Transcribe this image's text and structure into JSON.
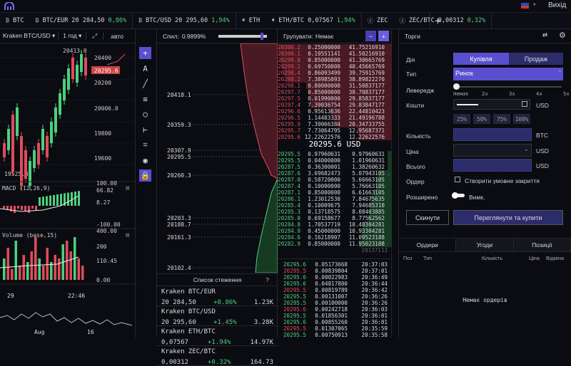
{
  "header": {
    "logout_label": "Вихід"
  },
  "ticker": [
    {
      "pair": "BTC",
      "price": "",
      "change": "",
      "dir": "",
      "icon": "btc-icon"
    },
    {
      "pair": "BTC/EUR",
      "price": "20 284,50",
      "change": "0,86%",
      "dir": "up",
      "icon": "btc-icon"
    },
    {
      "pair": "BTC/USD",
      "price": "20 295,60",
      "change": "1,94%",
      "dir": "up",
      "icon": "btc-icon"
    },
    {
      "pair": "ETH",
      "price": "",
      "change": "",
      "dir": "",
      "icon": "eth-icon"
    },
    {
      "pair": "ETH/BTC",
      "price": "0,07567",
      "change": "1,94%",
      "dir": "up",
      "icon": "eth-icon"
    },
    {
      "pair": "ZEC",
      "price": "",
      "change": "",
      "dir": "",
      "icon": "zec-icon"
    },
    {
      "pair": "ZEC/BTC",
      "price": "0,00312",
      "change": "0,32%",
      "dir": "up",
      "icon": "zec-icon"
    }
  ],
  "chart": {
    "market": "Kraken BTC/USD",
    "interval": "1 год",
    "mode": "авто",
    "price_labels": [
      "20413.0",
      "20400",
      "20295.6",
      "20200",
      "20006.0",
      "19800",
      "19600",
      "19525.8"
    ],
    "macd_label": "MACD (12,26,9)",
    "macd_ticks": [
      "100.00",
      "66.82",
      "8.27",
      "-100.00"
    ],
    "vol_label": "Volume (base,15)",
    "vol_ticks": [
      "400.00",
      "200",
      "110.45",
      "0.00"
    ],
    "time_labels": [
      "29",
      "22:46"
    ],
    "date_labels": [
      "Aug",
      "16"
    ]
  },
  "depth": {
    "spread_label": "Спил:",
    "spread_value": "0.9899%",
    "levels": [
      "20418.1",
      "20359.3",
      "20307.9",
      "20295.5",
      "20260.3",
      "20203.3",
      "20188.7",
      "20161.3",
      "20102.4"
    ],
    "watch_title": "Список стеження",
    "watch_help": "?"
  },
  "watchlist": [
    {
      "name": "Kraken BTC/EUR",
      "price": "20 284,50",
      "change": "+0.86%",
      "vol": "1.23K"
    },
    {
      "name": "Kraken BTC/USD",
      "price": "20 295,60",
      "change": "+1.45%",
      "vol": "3.28K"
    },
    {
      "name": "Kraken ETH/BTC",
      "price": "0,07567",
      "change": "+1.94%",
      "vol": "14.97K"
    },
    {
      "name": "Kraken ZEC/BTC",
      "price": "0,00312",
      "change": "+0.32%",
      "vol": "164.73"
    }
  ],
  "orderbook": {
    "group_label": "Групувати:",
    "group_value": "Немає",
    "mid_price": "20295.6 USD",
    "time": "20137113",
    "asks": [
      [
        "20300.2",
        "0.25000000",
        "41.75216910"
      ],
      [
        "20300.1",
        "0.19551141",
        "41.50216910"
      ],
      [
        "20299.8",
        "0.85000000",
        "41.30665769"
      ],
      [
        "20299.2",
        "0.69750000",
        "40.45665769"
      ],
      [
        "20298.4",
        "0.86093499",
        "39.75915769"
      ],
      [
        "20298.2",
        "7.38985093",
        "38.89822270"
      ],
      [
        "20298.1",
        "0.80000000",
        "31.50837177"
      ],
      [
        "20297.7",
        "0.85000000",
        "30.70837177"
      ],
      [
        "20297.5",
        "0.01990000",
        "29.85837177"
      ],
      [
        "20297.4",
        "7.39036754",
        "29.83847177"
      ],
      [
        "20296.6",
        "0.95613636",
        "22.44810423"
      ],
      [
        "20296.5",
        "1.14483333",
        "21.49196788"
      ],
      [
        "20295.9",
        "7.39066384",
        "20.34733755"
      ],
      [
        "20295.7",
        "7.73064795",
        "12.95687371"
      ],
      [
        "20295.6",
        "12.22622576",
        "12.22622576"
      ]
    ],
    "bids": [
      [
        "20295.5",
        "0.97960631",
        "0.97960631"
      ],
      [
        "20295.5",
        "0.04000000",
        "1.01960631"
      ],
      [
        "20287.5",
        "0.36300001",
        "1.38260632"
      ],
      [
        "20287.6",
        "3.69682473",
        "5.07943105"
      ],
      [
        "20287.0",
        "0.58720000",
        "5.66663105"
      ],
      [
        "20287.4",
        "0.10000000",
        "5.76663105"
      ],
      [
        "20287.1",
        "0.85000000",
        "6.61663105"
      ],
      [
        "20286.1",
        "1.23012530",
        "7.84675635"
      ],
      [
        "20285.4",
        "0.10009675",
        "7.94685310"
      ],
      [
        "20285.3",
        "0.13718575",
        "8.08403885"
      ],
      [
        "20285.0",
        "0.69158677",
        "8.77562562"
      ],
      [
        "20284.8",
        "1.70537719",
        "10.48304281"
      ],
      [
        "20284.9",
        "0.45000000",
        "10.93304281"
      ],
      [
        "20284.6",
        "0.16218907",
        "11.09523188"
      ],
      [
        "20282.9",
        "0.85000000",
        "11.95023188"
      ]
    ],
    "trades": [
      [
        "20295.6",
        "0.05173668",
        "20:37:03"
      ],
      [
        "20295.5",
        "0.00839804",
        "20:37:01"
      ],
      [
        "20295.6",
        "0.00022983",
        "20:36:49"
      ],
      [
        "20295.6",
        "0.04817800",
        "20:36:44"
      ],
      [
        "20295.5",
        "0.00819789",
        "20:36:42"
      ],
      [
        "20295.5",
        "0.00131007",
        "20:36:26"
      ],
      [
        "20295.5",
        "0.00100000",
        "20:36:26"
      ],
      [
        "20295.6",
        "0.00242718",
        "20:36:03"
      ],
      [
        "20295.5",
        "0.01856301",
        "20:36:01"
      ],
      [
        "20295.6",
        "0.00855260",
        "20:36:01"
      ],
      [
        "20295.5",
        "0.01307065",
        "20:35:59"
      ],
      [
        "20295.5",
        "0.00750913",
        "20:35:58"
      ]
    ]
  },
  "trade": {
    "title": "Торги",
    "action_label": "Дія",
    "buy_label": "Купівля",
    "sell_label": "Продаж",
    "type_label": "Тип",
    "type_value": "Ринок",
    "leverage_label": "Левередж",
    "leverage_ticks": [
      "Немає",
      "2x",
      "3x",
      "4x",
      "5x"
    ],
    "amount_label": "Кошти",
    "amount_unit": "USD",
    "pct": [
      "25%",
      "50%",
      "75%",
      "100%"
    ],
    "qty_label": "Кількість",
    "qty_unit": "BTC",
    "price_label": "Ціна",
    "price_value": "-",
    "price_unit": "USD",
    "total_label": "Всього",
    "total_unit": "USD",
    "order_label": "Ордер",
    "order_check": "Створити умовне закриття",
    "ext_label": "Розширено",
    "ext_value": "Вимк.",
    "reset_label": "Скинути",
    "review_label": "Переглянути та купити"
  },
  "orders": {
    "tabs": [
      "Ордери",
      "Угоди",
      "Позиції"
    ],
    "cols": [
      "Поз",
      "Тип",
      "Кількість",
      "Ціна",
      "Відміна"
    ],
    "empty": "Немає ордерів"
  },
  "colors": {
    "accent": "#5a4fcf",
    "up": "#4cd07d",
    "down": "#e04c5c"
  }
}
